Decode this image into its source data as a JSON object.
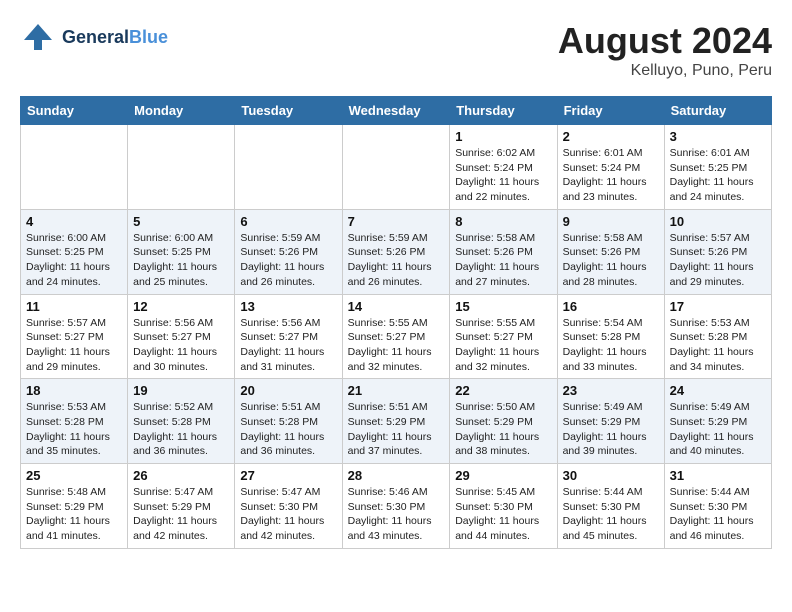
{
  "header": {
    "logo_line1": "General",
    "logo_line2": "Blue",
    "month_title": "August 2024",
    "location": "Kelluyo, Puno, Peru"
  },
  "weekdays": [
    "Sunday",
    "Monday",
    "Tuesday",
    "Wednesday",
    "Thursday",
    "Friday",
    "Saturday"
  ],
  "weeks": [
    [
      {
        "day": "",
        "info": ""
      },
      {
        "day": "",
        "info": ""
      },
      {
        "day": "",
        "info": ""
      },
      {
        "day": "",
        "info": ""
      },
      {
        "day": "1",
        "info": "Sunrise: 6:02 AM\nSunset: 5:24 PM\nDaylight: 11 hours and 22 minutes."
      },
      {
        "day": "2",
        "info": "Sunrise: 6:01 AM\nSunset: 5:24 PM\nDaylight: 11 hours and 23 minutes."
      },
      {
        "day": "3",
        "info": "Sunrise: 6:01 AM\nSunset: 5:25 PM\nDaylight: 11 hours and 24 minutes."
      }
    ],
    [
      {
        "day": "4",
        "info": "Sunrise: 6:00 AM\nSunset: 5:25 PM\nDaylight: 11 hours and 24 minutes."
      },
      {
        "day": "5",
        "info": "Sunrise: 6:00 AM\nSunset: 5:25 PM\nDaylight: 11 hours and 25 minutes."
      },
      {
        "day": "6",
        "info": "Sunrise: 5:59 AM\nSunset: 5:26 PM\nDaylight: 11 hours and 26 minutes."
      },
      {
        "day": "7",
        "info": "Sunrise: 5:59 AM\nSunset: 5:26 PM\nDaylight: 11 hours and 26 minutes."
      },
      {
        "day": "8",
        "info": "Sunrise: 5:58 AM\nSunset: 5:26 PM\nDaylight: 11 hours and 27 minutes."
      },
      {
        "day": "9",
        "info": "Sunrise: 5:58 AM\nSunset: 5:26 PM\nDaylight: 11 hours and 28 minutes."
      },
      {
        "day": "10",
        "info": "Sunrise: 5:57 AM\nSunset: 5:26 PM\nDaylight: 11 hours and 29 minutes."
      }
    ],
    [
      {
        "day": "11",
        "info": "Sunrise: 5:57 AM\nSunset: 5:27 PM\nDaylight: 11 hours and 29 minutes."
      },
      {
        "day": "12",
        "info": "Sunrise: 5:56 AM\nSunset: 5:27 PM\nDaylight: 11 hours and 30 minutes."
      },
      {
        "day": "13",
        "info": "Sunrise: 5:56 AM\nSunset: 5:27 PM\nDaylight: 11 hours and 31 minutes."
      },
      {
        "day": "14",
        "info": "Sunrise: 5:55 AM\nSunset: 5:27 PM\nDaylight: 11 hours and 32 minutes."
      },
      {
        "day": "15",
        "info": "Sunrise: 5:55 AM\nSunset: 5:27 PM\nDaylight: 11 hours and 32 minutes."
      },
      {
        "day": "16",
        "info": "Sunrise: 5:54 AM\nSunset: 5:28 PM\nDaylight: 11 hours and 33 minutes."
      },
      {
        "day": "17",
        "info": "Sunrise: 5:53 AM\nSunset: 5:28 PM\nDaylight: 11 hours and 34 minutes."
      }
    ],
    [
      {
        "day": "18",
        "info": "Sunrise: 5:53 AM\nSunset: 5:28 PM\nDaylight: 11 hours and 35 minutes."
      },
      {
        "day": "19",
        "info": "Sunrise: 5:52 AM\nSunset: 5:28 PM\nDaylight: 11 hours and 36 minutes."
      },
      {
        "day": "20",
        "info": "Sunrise: 5:51 AM\nSunset: 5:28 PM\nDaylight: 11 hours and 36 minutes."
      },
      {
        "day": "21",
        "info": "Sunrise: 5:51 AM\nSunset: 5:29 PM\nDaylight: 11 hours and 37 minutes."
      },
      {
        "day": "22",
        "info": "Sunrise: 5:50 AM\nSunset: 5:29 PM\nDaylight: 11 hours and 38 minutes."
      },
      {
        "day": "23",
        "info": "Sunrise: 5:49 AM\nSunset: 5:29 PM\nDaylight: 11 hours and 39 minutes."
      },
      {
        "day": "24",
        "info": "Sunrise: 5:49 AM\nSunset: 5:29 PM\nDaylight: 11 hours and 40 minutes."
      }
    ],
    [
      {
        "day": "25",
        "info": "Sunrise: 5:48 AM\nSunset: 5:29 PM\nDaylight: 11 hours and 41 minutes."
      },
      {
        "day": "26",
        "info": "Sunrise: 5:47 AM\nSunset: 5:29 PM\nDaylight: 11 hours and 42 minutes."
      },
      {
        "day": "27",
        "info": "Sunrise: 5:47 AM\nSunset: 5:30 PM\nDaylight: 11 hours and 42 minutes."
      },
      {
        "day": "28",
        "info": "Sunrise: 5:46 AM\nSunset: 5:30 PM\nDaylight: 11 hours and 43 minutes."
      },
      {
        "day": "29",
        "info": "Sunrise: 5:45 AM\nSunset: 5:30 PM\nDaylight: 11 hours and 44 minutes."
      },
      {
        "day": "30",
        "info": "Sunrise: 5:44 AM\nSunset: 5:30 PM\nDaylight: 11 hours and 45 minutes."
      },
      {
        "day": "31",
        "info": "Sunrise: 5:44 AM\nSunset: 5:30 PM\nDaylight: 11 hours and 46 minutes."
      }
    ]
  ]
}
